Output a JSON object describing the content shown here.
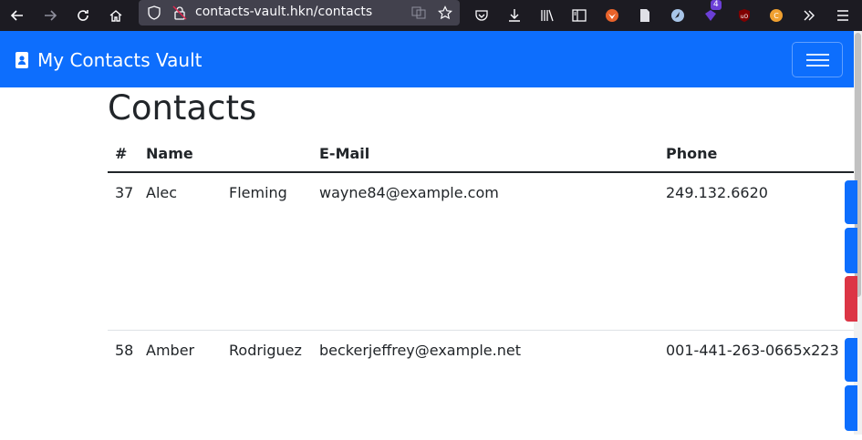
{
  "browser": {
    "url": "contacts-vault.hkn/contacts",
    "extension_badge": "4"
  },
  "navbar": {
    "brand": "My Contacts Vault",
    "brand_icon": "address-book-icon",
    "toggler_icon": "hamburger-icon"
  },
  "page": {
    "title": "Contacts"
  },
  "table": {
    "headers": {
      "num": "#",
      "name": "Name",
      "email": "E-Mail",
      "phone": "Phone"
    },
    "rows": [
      {
        "num": "37",
        "first": "Alec",
        "last": "Fleming",
        "email": "wayne84@example.com",
        "phone": "249.132.6620"
      },
      {
        "num": "58",
        "first": "Amber",
        "last": "Rodriguez",
        "email": "beckerjeffrey@example.net",
        "phone": "001-441-263-0665x223"
      }
    ]
  },
  "colors": {
    "primary": "#0d6efd",
    "danger": "#dc3545",
    "chrome": "#1c1b22"
  }
}
